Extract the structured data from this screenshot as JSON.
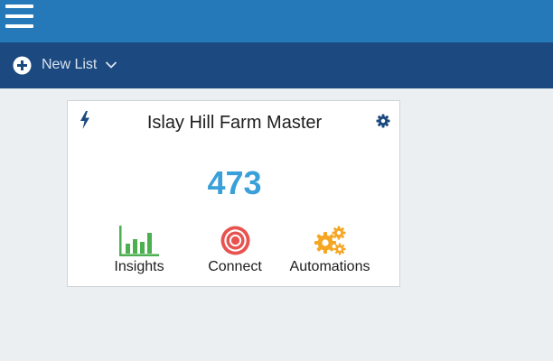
{
  "header": {
    "menu_icon": "hamburger-menu-icon"
  },
  "toolbar": {
    "new_list_label": "New List",
    "plus_icon": "plus-circle-icon",
    "chevron_icon": "chevron-down-icon"
  },
  "card": {
    "title": "Islay Hill Farm Master",
    "count": "473",
    "bolt_icon": "lightning-bolt-icon",
    "gear_icon": "gear-icon",
    "actions": [
      {
        "label": "Insights",
        "icon": "bar-chart-icon",
        "color": "#4caf50"
      },
      {
        "label": "Connect",
        "icon": "target-icon",
        "color": "#e8524f"
      },
      {
        "label": "Automations",
        "icon": "gears-icon",
        "color": "#f5a623"
      }
    ]
  },
  "colors": {
    "topbar": "#2579b8",
    "subbar": "#1c4a80",
    "background": "#eceff2",
    "count": "#3aa0d9",
    "icon_dark": "#1c4a80"
  }
}
